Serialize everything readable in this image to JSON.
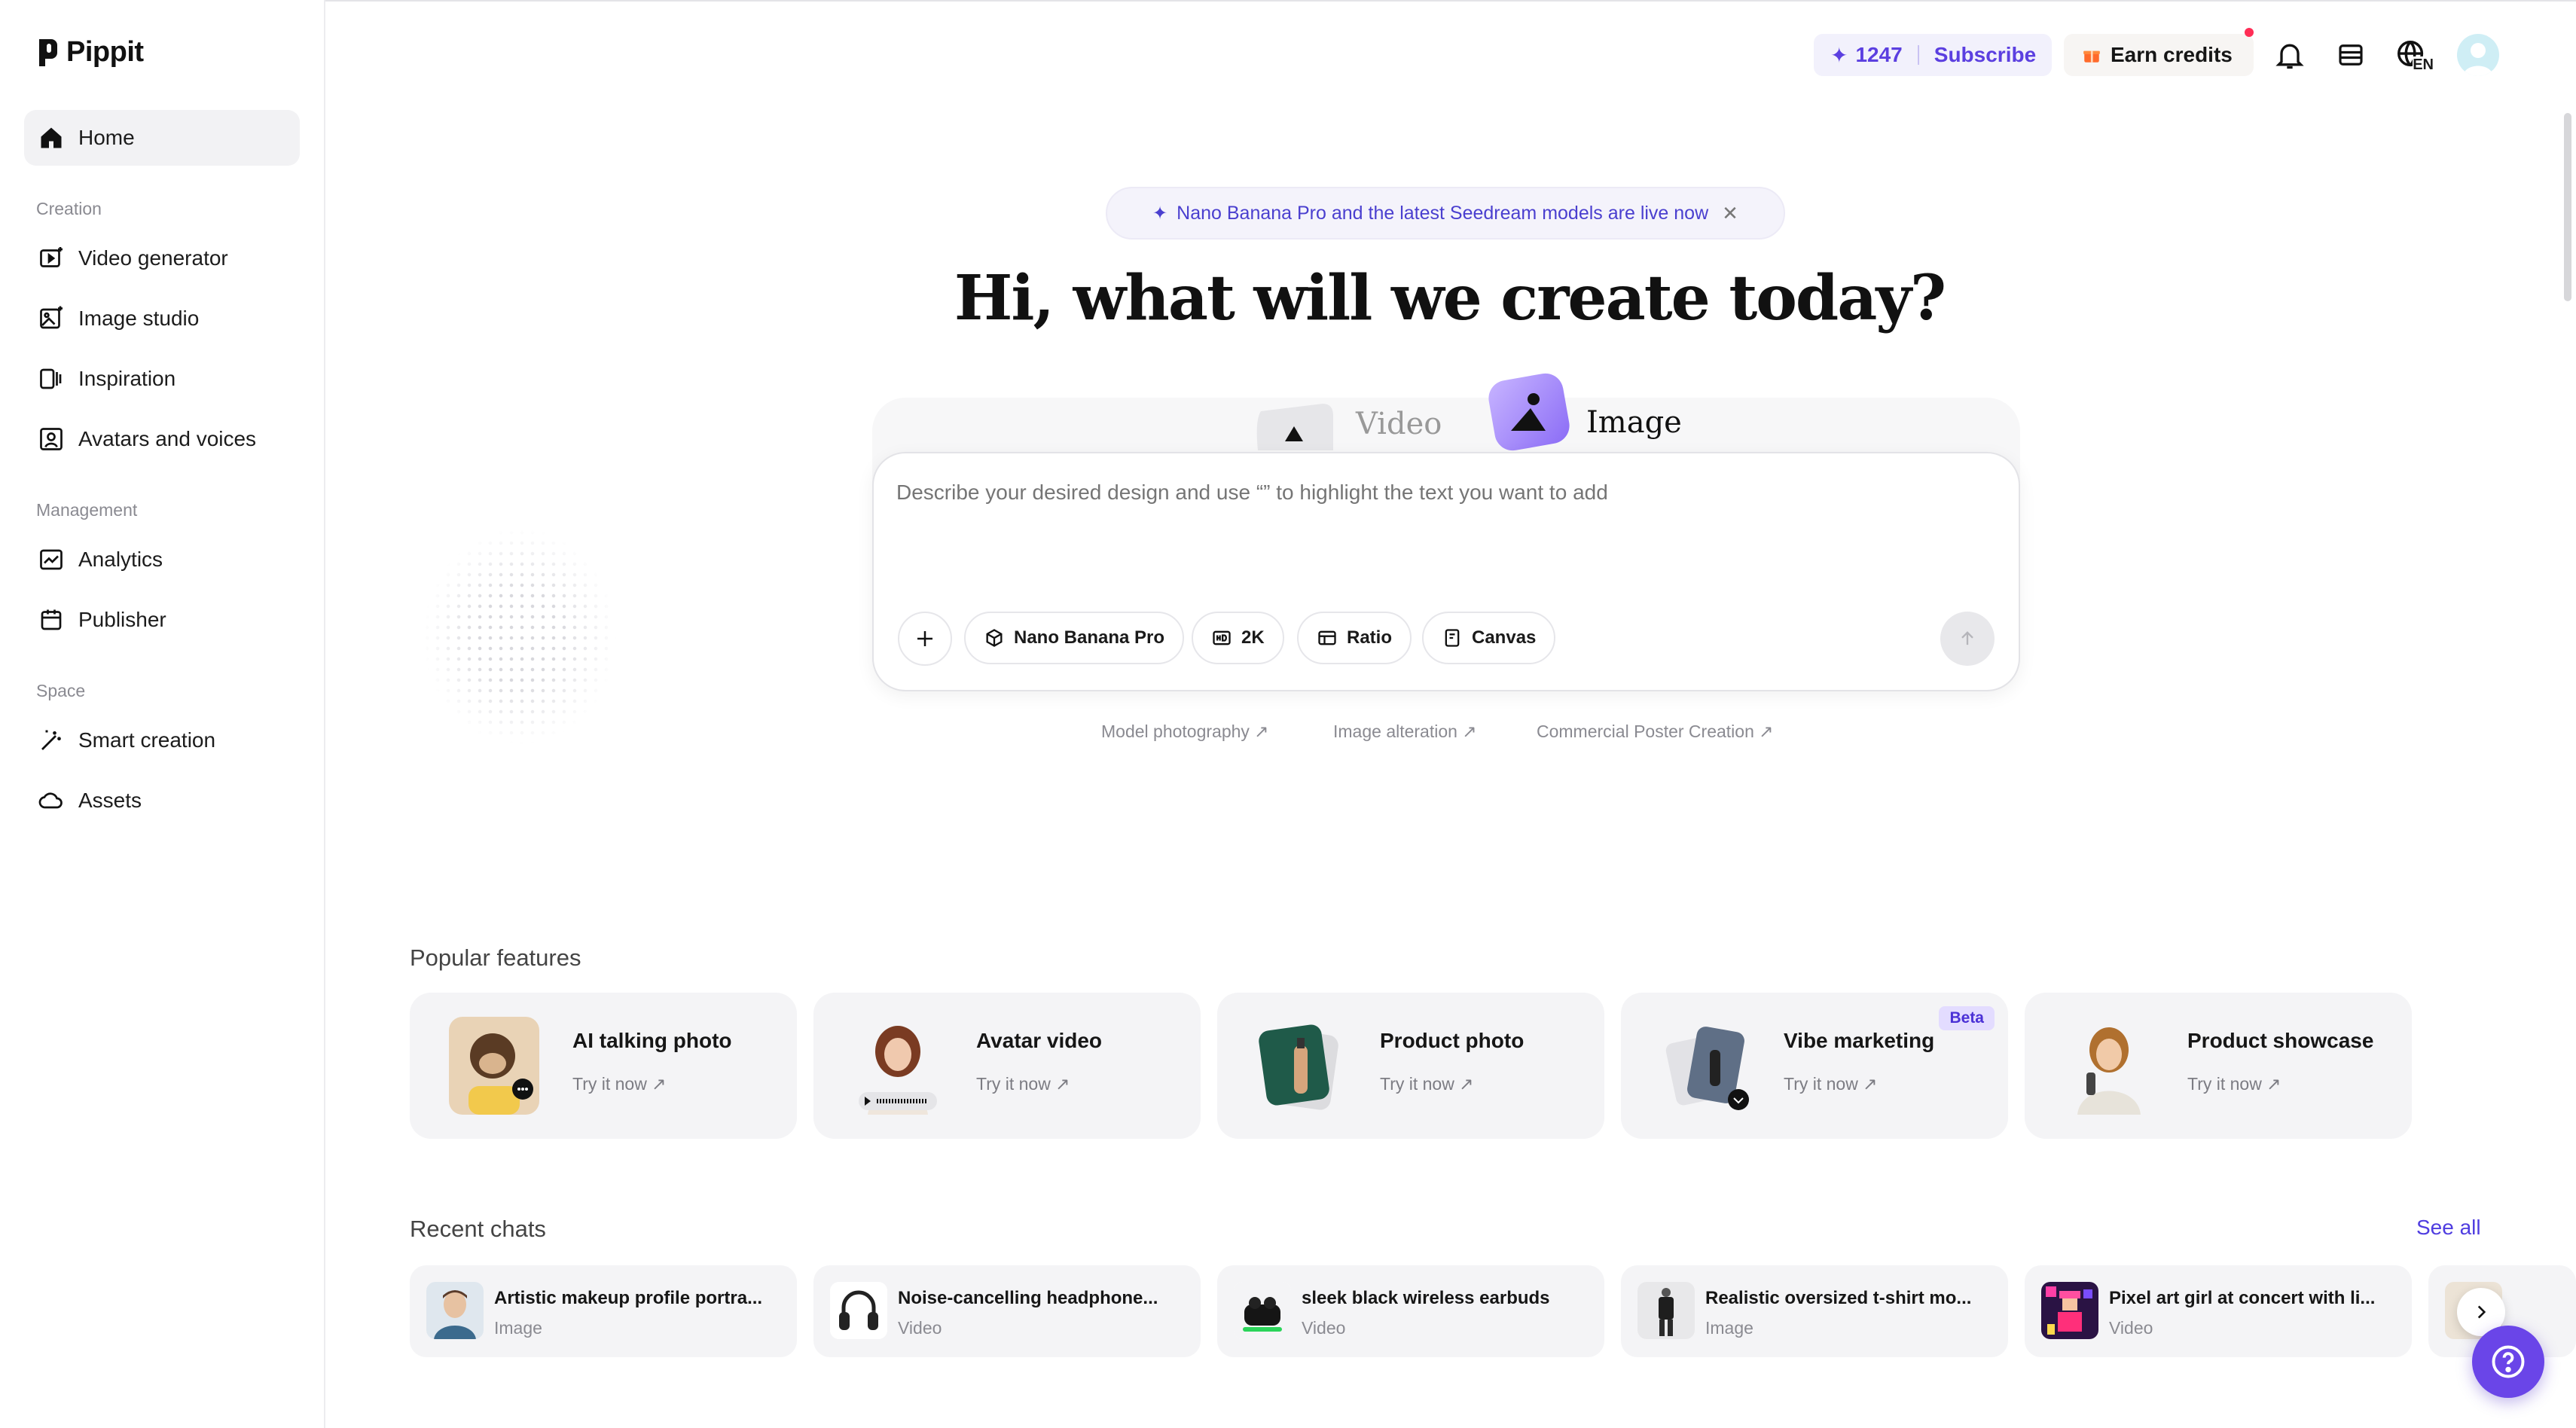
{
  "brand": {
    "name": "Pippit"
  },
  "sidebar": {
    "home": "Home",
    "sections": {
      "creation": "Creation",
      "management": "Management",
      "space": "Space"
    },
    "creation_items": [
      "Video generator",
      "Image studio",
      "Inspiration",
      "Avatars and voices"
    ],
    "management_items": [
      "Analytics",
      "Publisher"
    ],
    "space_items": [
      "Smart creation",
      "Assets"
    ]
  },
  "topbar": {
    "credits": "1247",
    "subscribe": "Subscribe",
    "earn_credits": "Earn credits",
    "language": "EN"
  },
  "hero": {
    "banner": "Nano Banana Pro and the latest Seedream models are live now",
    "title": "Hi, what will we create today?",
    "tabs": {
      "video": "Video",
      "image": "Image",
      "active": "Image"
    },
    "prompt_placeholder": "Describe your desired design and use “” to highlight the text you want to add",
    "chips": {
      "model": "Nano Banana Pro",
      "resolution": "2K",
      "ratio": "Ratio",
      "canvas": "Canvas"
    },
    "suggestions": [
      "Model photography ↗",
      "Image alteration ↗",
      "Commercial Poster Creation ↗"
    ]
  },
  "popular": {
    "title": "Popular features",
    "items": [
      {
        "title": "AI talking photo",
        "cta": "Try it now ↗",
        "badge": ""
      },
      {
        "title": "Avatar video",
        "cta": "Try it now ↗",
        "badge": ""
      },
      {
        "title": "Product photo",
        "cta": "Try it now ↗",
        "badge": ""
      },
      {
        "title": "Vibe marketing",
        "cta": "Try it now ↗",
        "badge": "Beta"
      },
      {
        "title": "Product showcase",
        "cta": "Try it now ↗",
        "badge": ""
      }
    ]
  },
  "recent": {
    "title": "Recent chats",
    "see_all": "See all",
    "items": [
      {
        "title": "Artistic makeup profile portra...",
        "type": "Image"
      },
      {
        "title": "Noise-cancelling headphone...",
        "type": "Video"
      },
      {
        "title": "sleek black wireless earbuds",
        "type": "Video"
      },
      {
        "title": "Realistic oversized t-shirt mo...",
        "type": "Image"
      },
      {
        "title": "Pixel art girl at concert with li...",
        "type": "Video"
      }
    ]
  },
  "colors": {
    "accent": "#5b3fe0",
    "help": "#6a45e8",
    "card_bg": "#f4f4f6"
  }
}
